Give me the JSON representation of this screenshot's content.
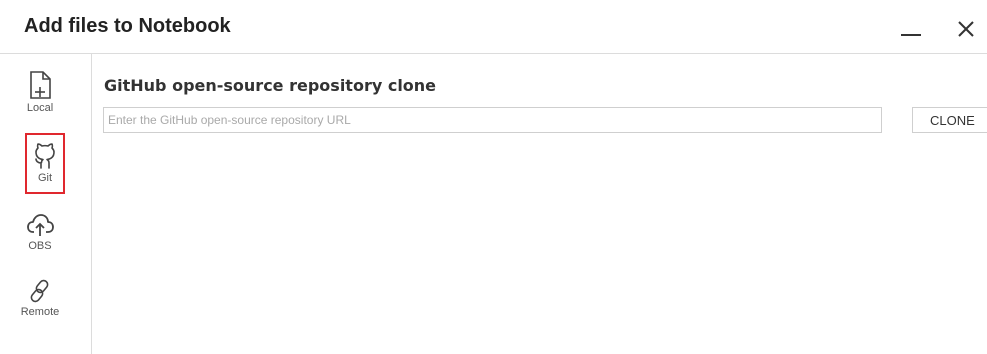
{
  "window": {
    "title": "Add files to Notebook",
    "minimize_icon": "minimize-icon",
    "close_icon": "close-icon"
  },
  "sidebar": {
    "items": [
      {
        "label": "Local",
        "icon": "file-add-icon",
        "active": false
      },
      {
        "label": "Git",
        "icon": "github-icon",
        "active": true
      },
      {
        "label": "OBS",
        "icon": "cloud-upload-icon",
        "active": false
      },
      {
        "label": "Remote",
        "icon": "link-icon",
        "active": false
      }
    ]
  },
  "main": {
    "heading": "GitHub open-source repository clone",
    "url_input": {
      "value": "",
      "placeholder": "Enter the GitHub open-source repository URL"
    },
    "clone_label": "CLONE"
  },
  "colors": {
    "active_highlight": "#e0282e",
    "border": "#dcdcdc"
  }
}
